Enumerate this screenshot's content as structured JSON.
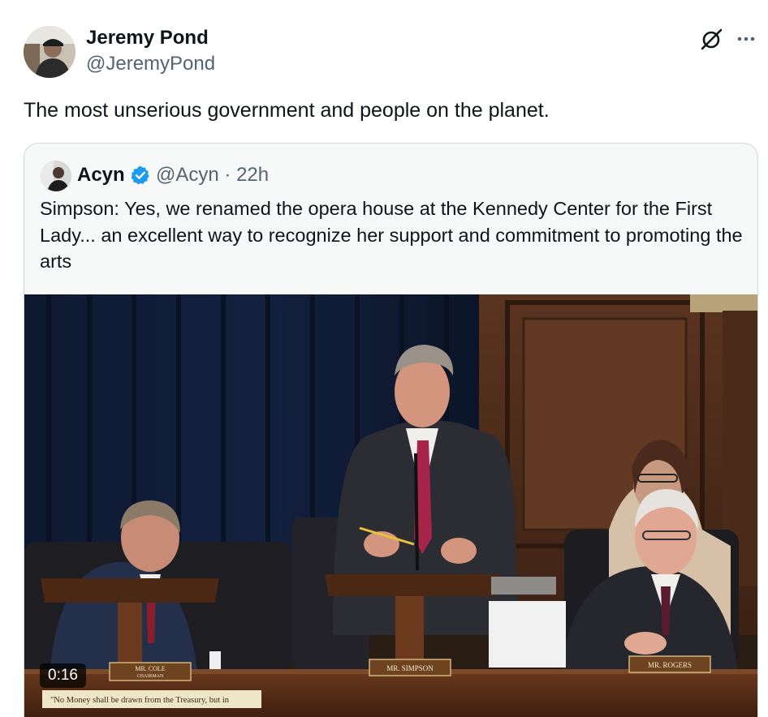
{
  "tweet": {
    "author": {
      "display_name": "Jeremy Pond",
      "handle": "@JeremyPond",
      "avatar_icon": "profile-photo"
    },
    "actions": {
      "grok_icon": "grok-icon",
      "more_icon": "more-options-icon"
    },
    "text": "The most unserious government and people on the planet."
  },
  "quoted_tweet": {
    "author": {
      "display_name": "Acyn",
      "verified": true,
      "verified_color": "#1d9bf0",
      "handle": "@Acyn",
      "separator": "·",
      "time_ago": "22h"
    },
    "text": "Simpson: Yes, we renamed the opera house at the Kennedy Center for the First Lady... an excellent way to recognize her support and commitment to promoting the arts",
    "media": {
      "type": "video",
      "duration": "0:16",
      "nameplates": {
        "cole": "MR. COLE",
        "cole_title": "CHAIRMAN",
        "simpson": "MR. SIMPSON",
        "rogers": "MR. ROGERS"
      },
      "desk_inscription": "\"No Money shall be drawn from the Treasury, but in"
    }
  }
}
